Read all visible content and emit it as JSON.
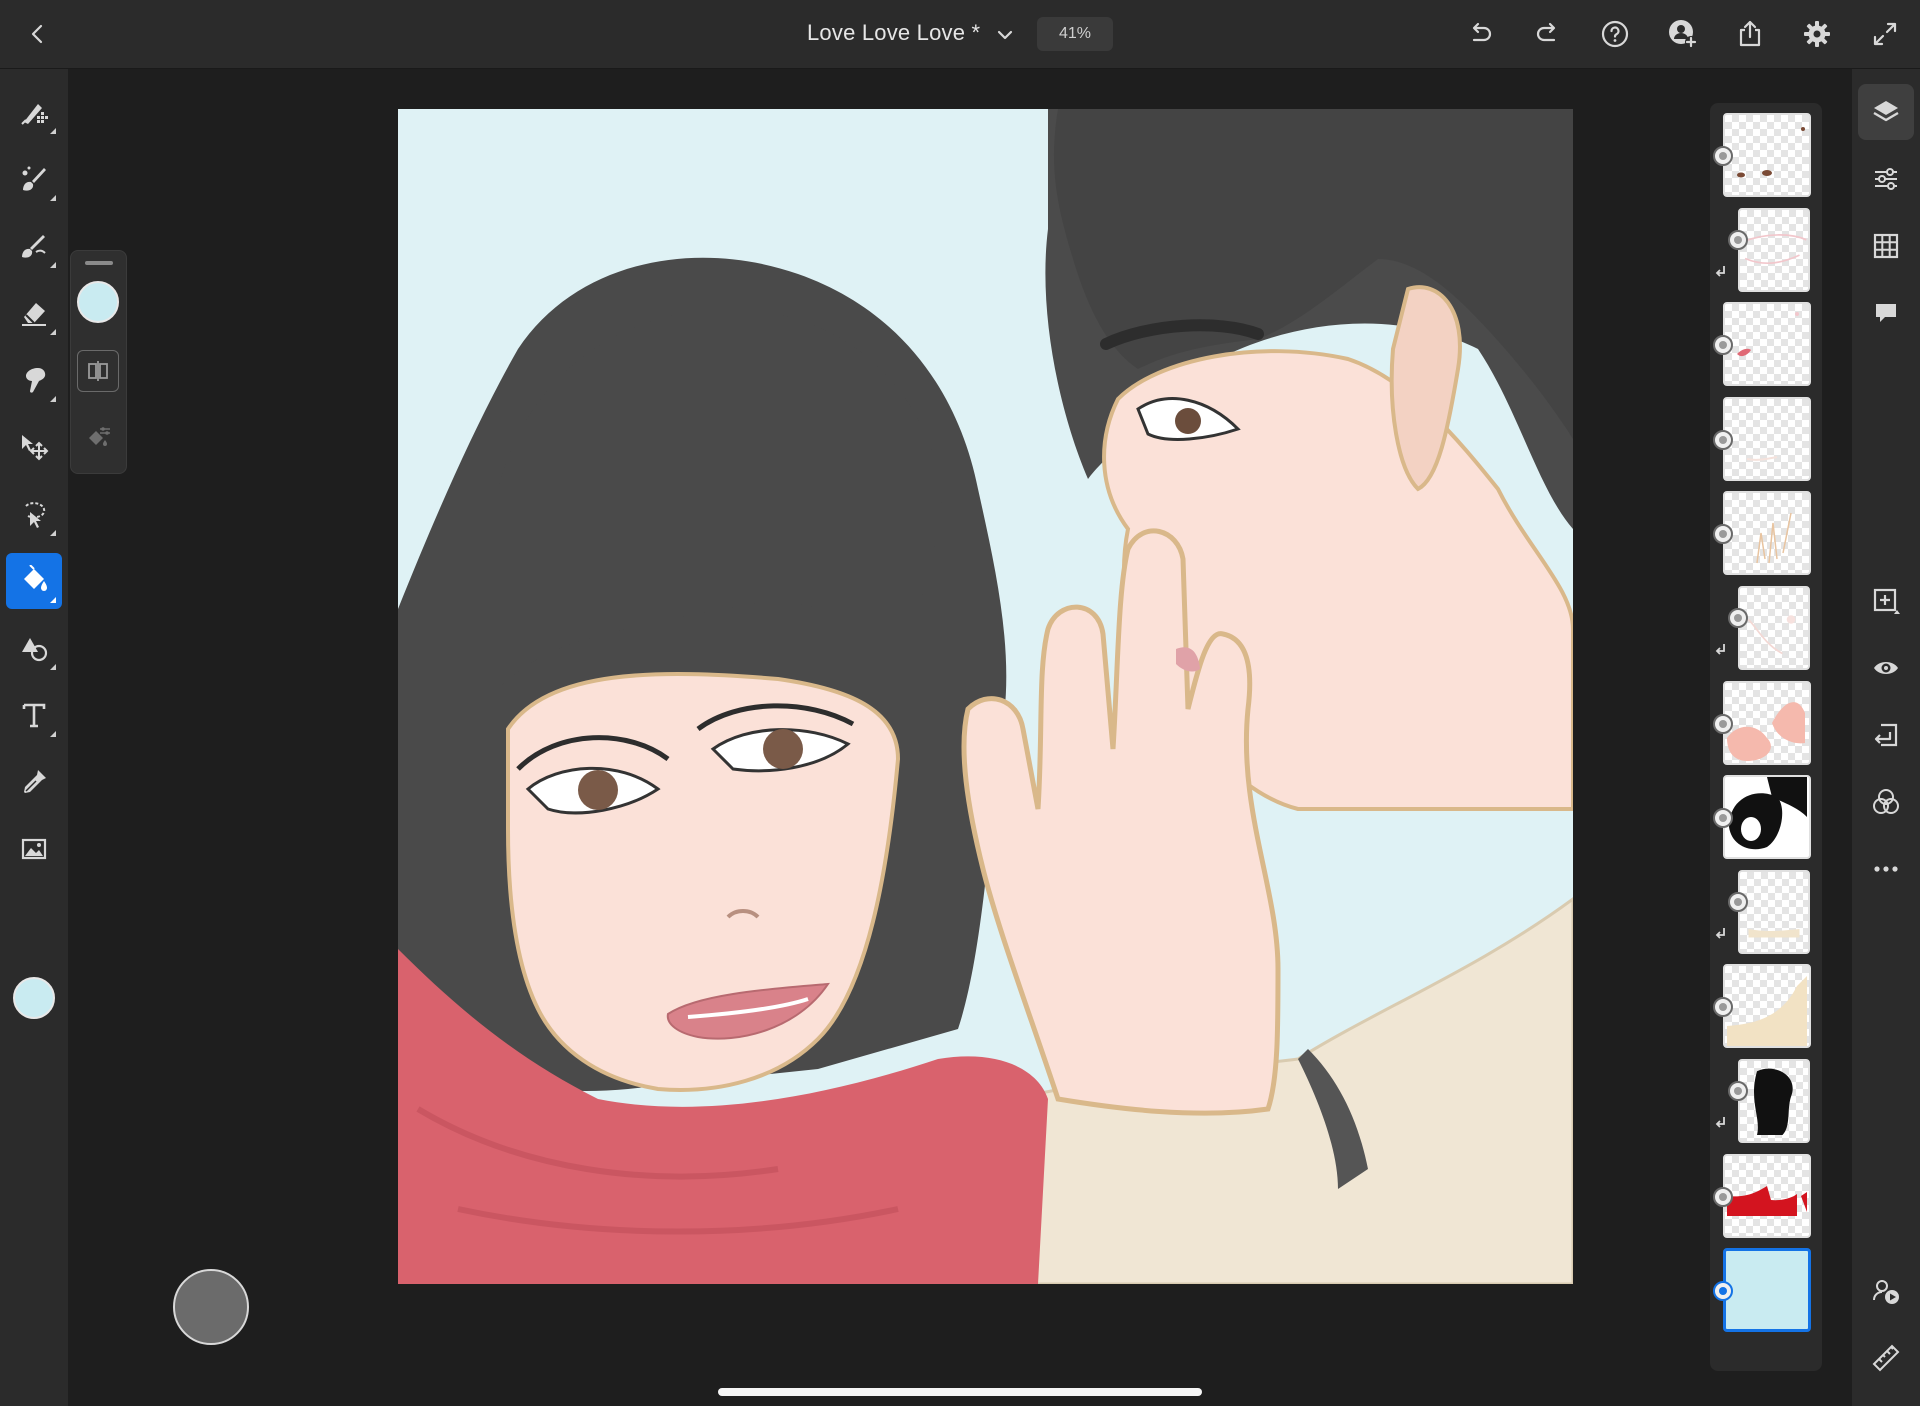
{
  "app": {
    "document_title": "Love Love Love *",
    "zoom": "41%"
  },
  "colors": {
    "accent": "#1473e6",
    "current_color": "#c9ebf1",
    "chrome_bg": "#2b2b2b",
    "workspace_bg": "#1e1e1e"
  },
  "top_bar": {
    "icons": [
      "back-icon",
      "chevron-down-icon",
      "undo-icon",
      "redo-icon",
      "help-icon",
      "invite-icon",
      "share-icon",
      "settings-icon",
      "fullscreen-icon"
    ]
  },
  "left_tools": [
    {
      "name": "pixel-brush-tool",
      "icon": "pixel-brush-icon",
      "active": false
    },
    {
      "name": "live-brush-tool",
      "icon": "live-brush-icon",
      "active": false
    },
    {
      "name": "vector-brush-tool",
      "icon": "vector-brush-icon",
      "active": false
    },
    {
      "name": "eraser-tool",
      "icon": "eraser-icon",
      "active": false
    },
    {
      "name": "smudge-tool",
      "icon": "smudge-icon",
      "active": false
    },
    {
      "name": "transform-tool",
      "icon": "move-icon",
      "active": false
    },
    {
      "name": "selection-tool",
      "icon": "lasso-icon",
      "active": false
    },
    {
      "name": "fill-tool",
      "icon": "paint-bucket-icon",
      "active": true
    },
    {
      "name": "shapes-tool",
      "icon": "shapes-icon",
      "active": false
    },
    {
      "name": "text-tool",
      "icon": "text-icon",
      "active": false
    },
    {
      "name": "eyedropper-tool",
      "icon": "eyedropper-icon",
      "active": false
    },
    {
      "name": "image-tool",
      "icon": "image-icon",
      "active": false
    }
  ],
  "tool_options": {
    "swatch_color": "#c9ebf1",
    "items": [
      "fill-mode-icon",
      "fill-settings-icon"
    ]
  },
  "layers": [
    {
      "name": "layer-1",
      "clipped": false,
      "visible": true,
      "selected": false
    },
    {
      "name": "layer-2",
      "clipped": true,
      "visible": true,
      "selected": false
    },
    {
      "name": "layer-3",
      "clipped": false,
      "visible": true,
      "selected": false
    },
    {
      "name": "layer-4",
      "clipped": false,
      "visible": true,
      "selected": false
    },
    {
      "name": "layer-5",
      "clipped": false,
      "visible": true,
      "selected": false
    },
    {
      "name": "layer-6",
      "clipped": true,
      "visible": true,
      "selected": false
    },
    {
      "name": "layer-7",
      "clipped": false,
      "visible": true,
      "selected": false
    },
    {
      "name": "layer-8",
      "clipped": false,
      "visible": true,
      "selected": false
    },
    {
      "name": "layer-9",
      "clipped": true,
      "visible": true,
      "selected": false
    },
    {
      "name": "layer-10",
      "clipped": false,
      "visible": true,
      "selected": false
    },
    {
      "name": "layer-11",
      "clipped": true,
      "visible": true,
      "selected": false
    },
    {
      "name": "layer-12",
      "clipped": false,
      "visible": true,
      "selected": false
    },
    {
      "name": "layer-13",
      "clipped": false,
      "visible": true,
      "selected": true
    }
  ],
  "right_tools": [
    "layers-icon",
    "layer-properties-icon",
    "grid-icon",
    "comments-icon",
    "add-layer-icon",
    "visibility-icon",
    "import-icon",
    "blend-icon",
    "more-icon",
    "livestream-icon",
    "ruler-icon"
  ]
}
